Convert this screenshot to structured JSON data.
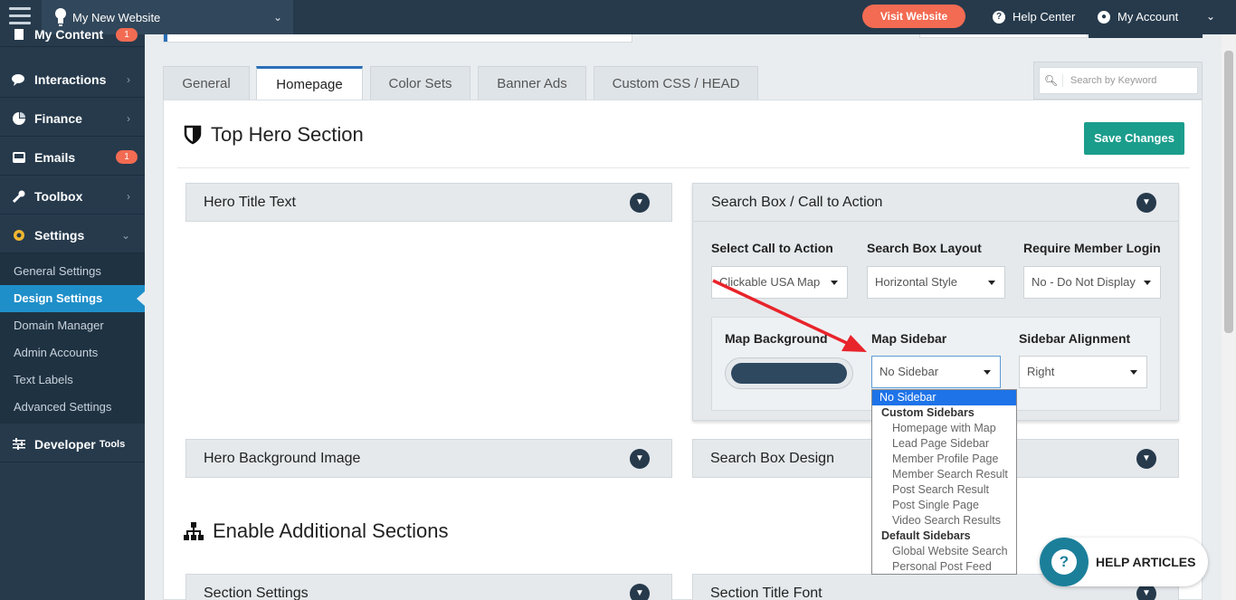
{
  "topbar": {
    "site_name": "My New Website",
    "visit_website": "Visit Website",
    "help_center": "Help Center",
    "my_account": "My Account"
  },
  "sidebar": {
    "items": [
      {
        "label": "My Content",
        "badge": "1"
      },
      {
        "label": "Interactions"
      },
      {
        "label": "Finance"
      },
      {
        "label": "Emails",
        "badge": "1"
      },
      {
        "label": "Toolbox"
      },
      {
        "label": "Settings"
      }
    ],
    "settings_sub": [
      {
        "label": "General Settings"
      },
      {
        "label": "Design Settings"
      },
      {
        "label": "Domain Manager"
      },
      {
        "label": "Admin Accounts"
      },
      {
        "label": "Text Labels"
      },
      {
        "label": "Advanced Settings"
      }
    ],
    "developer": {
      "label": "Developer",
      "suffix": "Tools"
    }
  },
  "tabs": [
    "General",
    "Homepage",
    "Color Sets",
    "Banner Ads",
    "Custom CSS / HEAD"
  ],
  "search": {
    "placeholder": "Search by Keyword"
  },
  "main": {
    "section_title": "Top Hero Section",
    "save_button": "Save Changes",
    "additional_title": "Enable Additional Sections",
    "accordions": {
      "hero_title": "Hero Title Text",
      "hero_bg": "Hero Background Image",
      "search_box_design": "Search Box Design",
      "section_settings": "Section Settings",
      "section_title_font": "Section Title Font"
    },
    "search_card": {
      "title": "Search Box / Call to Action",
      "cta_label": "Select Call to Action",
      "cta_value": "Clickable USA Map",
      "layout_label": "Search Box Layout",
      "layout_value": "Horizontal Style",
      "login_label": "Require Member Login",
      "login_value": "No - Do Not Display",
      "map_bg_label": "Map Background",
      "map_bg_color": "#2e4860",
      "map_sidebar_label": "Map Sidebar",
      "map_sidebar_value": "No Sidebar",
      "align_label": "Sidebar Alignment",
      "align_value": "Right"
    }
  },
  "dropdown": {
    "selected": "No Sidebar",
    "group1": "Custom Sidebars",
    "group1_options": [
      "Homepage with Map",
      "Lead Page Sidebar",
      "Member Profile Page",
      "Member Search Result",
      "Post Search Result",
      "Post Single Page",
      "Video Search Results"
    ],
    "group2": "Default Sidebars",
    "group2_options": [
      "Global Website Search",
      "Personal Post Feed"
    ]
  },
  "help_articles": "HELP ARTICLES",
  "colors": {
    "accent": "#1b9d8c",
    "visit": "#f26b52",
    "nav": "#263a4c",
    "active_sub": "#1f8fc9",
    "arrow": "#e8242b"
  }
}
